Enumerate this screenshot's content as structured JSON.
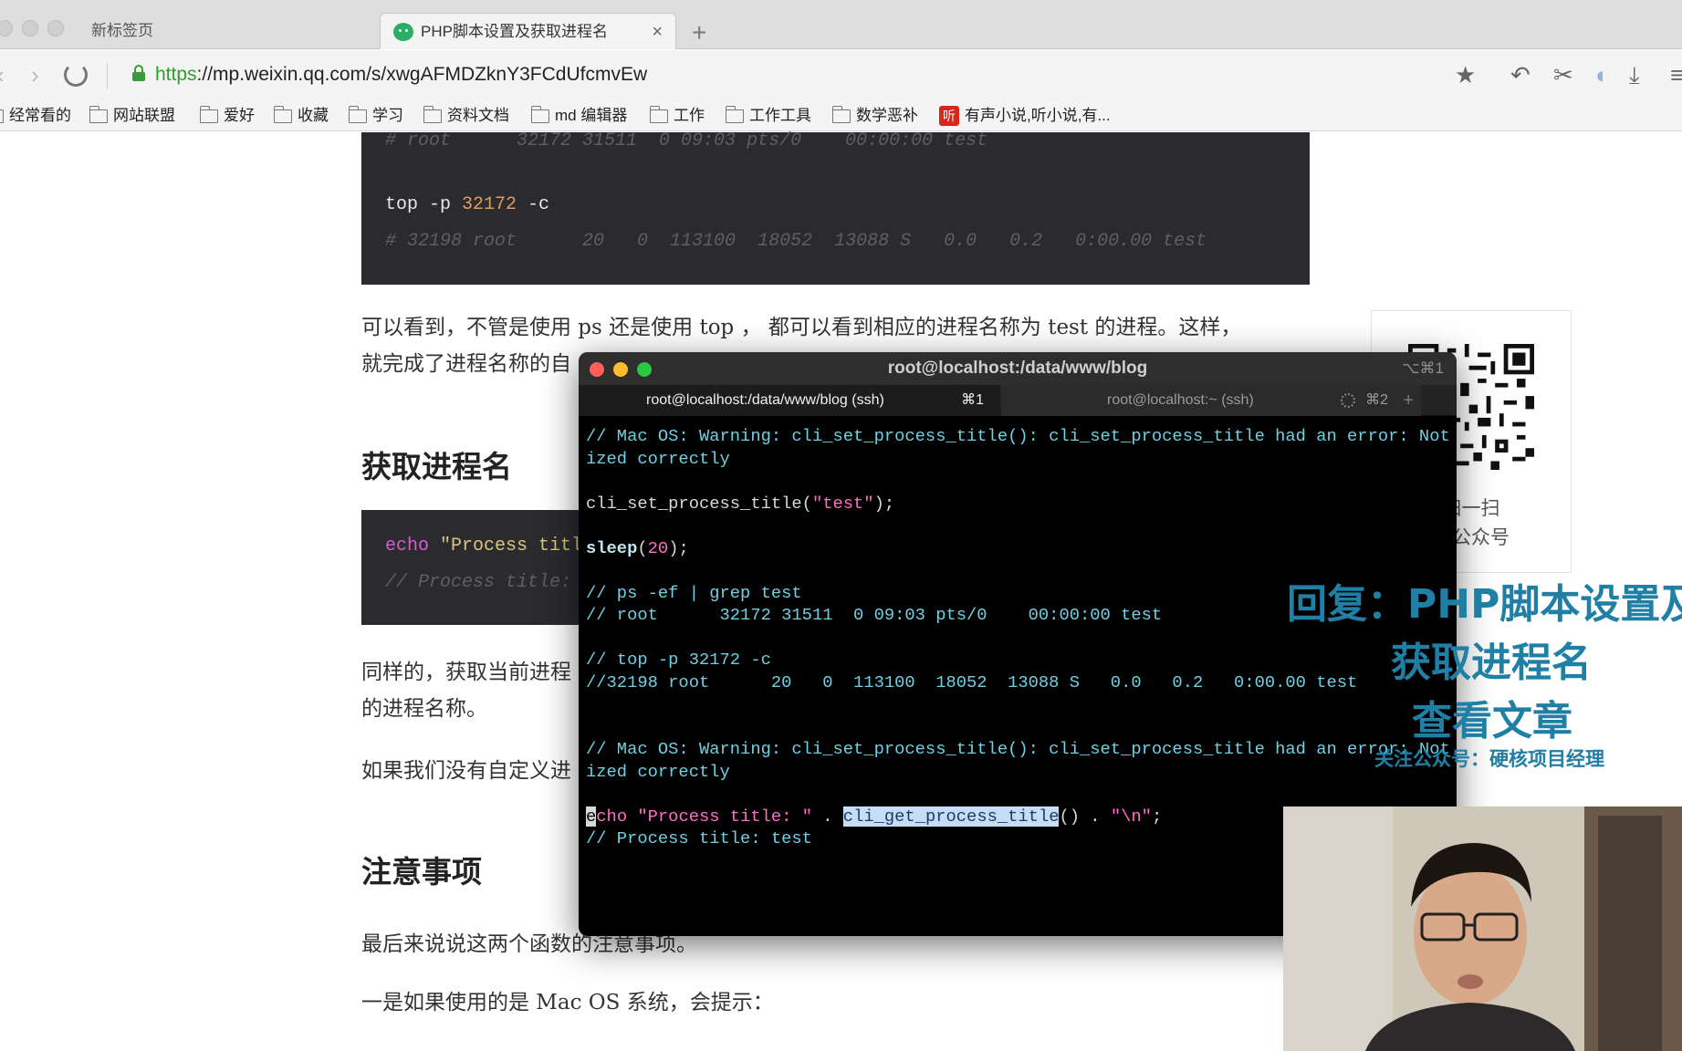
{
  "browser": {
    "tabs": [
      {
        "label": "新标签页"
      },
      {
        "label": "PHP脚本设置及获取进程名"
      }
    ],
    "tab_close": "×",
    "new_tab": "+",
    "url_scheme": "https",
    "url_rest": "://mp.weixin.qq.com/s/xwgAFMDZknY3FCdUfcmvEw",
    "bookmarks": [
      "经常看的",
      "网站联盟",
      "爱好",
      "收藏",
      "学习",
      "资料文档",
      "md 编辑器",
      "工作",
      "工作工具",
      "数学恶补",
      "有声小说,听小说,有..."
    ],
    "audio_badge": "听"
  },
  "article": {
    "code1": {
      "comment1": "# root      32172 31511  0 09:03 pts/0    00:00:00 test",
      "cmd_prefix": "top -p ",
      "cmd_num": "32172",
      "cmd_suffix": " -c",
      "comment2": "# 32198 root      20   0  113100  18052  13088 S   0.0   0.2   0:00.00 test"
    },
    "para1_line1": "可以看到，不管是使用 ps 还是使用 top ， 都可以看到相应的进程名称为 test 的进程。这样，",
    "para1_line2": "就完成了进程名称的自",
    "heading1": "获取进程名",
    "code2": {
      "kw": "echo",
      "str": " \"Process title",
      "comment": "// Process title: t"
    },
    "para2_line1": "同样的，获取当前进程",
    "para2_line2": "的进程名称。",
    "para3": "如果我们没有自定义进",
    "heading2": "注意事项",
    "para4": "最后来说说这两个函数的注意事项。",
    "para5": "一是如果使用的是 Mac OS 系统，会提示："
  },
  "qr": {
    "caption1": "扫一扫",
    "caption2": "该公众号"
  },
  "terminal": {
    "title": "root@localhost:/data/www/blog",
    "shortcut": "⌥⌘1",
    "tab1_label": "root@localhost:/data/www/blog (ssh)",
    "tab1_key": "⌘1",
    "tab2_label": "root@localhost:~ (ssh)",
    "tab2_key": "⌘2",
    "tab_add": "+",
    "lines": {
      "l1": "// Mac OS: Warning: cli_set_process_title(): cli_set_process_title had an error: Not initial",
      "l2": "ized correctly",
      "l3a": "cli_set_process_title(",
      "l3b": "\"test\"",
      "l3c": ");",
      "l4a": "sleep",
      "l4b": "(",
      "l4c": "20",
      "l4d": ");",
      "l5": "// ps -ef | grep test",
      "l6": "// root      32172 31511  0 09:03 pts/0    00:00:00 test",
      "l7": "// top -p 32172 -c",
      "l8": "//32198 root      20   0  113100  18052  13088 S   0.0   0.2   0:00.00 test",
      "l9": "// Mac OS: Warning: cli_set_process_title(): cli_set_process_title had an error: Not initial",
      "l10": "ized correctly",
      "l11_cursor": "e",
      "l11a": "cho ",
      "l11b": "\"Process title: \"",
      "l11c": " . ",
      "l11_sel": "cli_get_process_title",
      "l11d": "() . ",
      "l11e": "\"\\n\"",
      "l11f": ";",
      "l12": "// Process title: test"
    },
    "line_count": "17"
  },
  "overlay": {
    "line1": "回复：PHP脚本设置及",
    "line2": "获取进程名",
    "line3": "查看文章",
    "line4": "关注公众号：硬核项目经理"
  }
}
